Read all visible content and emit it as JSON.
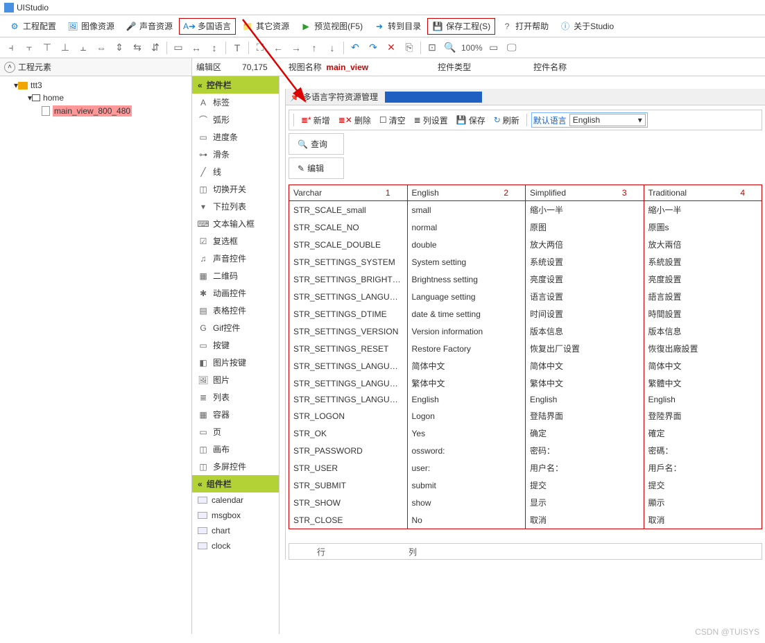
{
  "app_title": "UIStudio",
  "toolbar1": [
    {
      "id": "proj-config",
      "label": "工程配置",
      "icon": "gear"
    },
    {
      "id": "img-res",
      "label": "图像资源",
      "icon": "img"
    },
    {
      "id": "sound-res",
      "label": "声音资源",
      "icon": "mic"
    },
    {
      "id": "multi-lang",
      "label": "多国语言",
      "icon": "lang",
      "boxed": true
    },
    {
      "id": "other-res",
      "label": "其它资源",
      "icon": "folder"
    },
    {
      "id": "preview",
      "label": "预览视图(F5)",
      "icon": "play"
    },
    {
      "id": "goto-dir",
      "label": "转到目录",
      "icon": "goto"
    },
    {
      "id": "save-proj",
      "label": "保存工程(S)",
      "icon": "save",
      "boxed": true
    },
    {
      "id": "open-help",
      "label": "打开帮助",
      "icon": "help"
    },
    {
      "id": "about",
      "label": "关于Studio",
      "icon": "info"
    }
  ],
  "infobar": {
    "edit_area": "编辑区",
    "coords": "70,175",
    "view_name_label": "视图名称",
    "view_name": "main_view",
    "ctrl_type": "控件类型",
    "ctrl_name": "控件名称"
  },
  "left_header": "工程元素",
  "tree": {
    "root": "ttt3",
    "home": "home",
    "main": "main_view_800_480"
  },
  "mid": {
    "sec1": "控件栏",
    "items1": [
      {
        "id": "label",
        "label": "标签",
        "ic": "A"
      },
      {
        "id": "arc",
        "label": "弧形",
        "ic": "⌒"
      },
      {
        "id": "progress",
        "label": "进度条",
        "ic": "▭"
      },
      {
        "id": "slider",
        "label": "滑条",
        "ic": "⊶"
      },
      {
        "id": "line",
        "label": "线",
        "ic": "╱"
      },
      {
        "id": "switch",
        "label": "切换开关",
        "ic": "◫"
      },
      {
        "id": "dropdown",
        "label": "下拉列表",
        "ic": "▾"
      },
      {
        "id": "textinput",
        "label": "文本输入框",
        "ic": "⌨"
      },
      {
        "id": "checkbox",
        "label": "复选框",
        "ic": "☑"
      },
      {
        "id": "sound",
        "label": "声音控件",
        "ic": "♫"
      },
      {
        "id": "qrcode",
        "label": "二维码",
        "ic": "▦"
      },
      {
        "id": "anim",
        "label": "动画控件",
        "ic": "✱"
      },
      {
        "id": "table",
        "label": "表格控件",
        "ic": "▤"
      },
      {
        "id": "gif",
        "label": "Gif控件",
        "ic": "G"
      },
      {
        "id": "button",
        "label": "按键",
        "ic": "▭"
      },
      {
        "id": "imgbtn",
        "label": "图片按键",
        "ic": "◧"
      },
      {
        "id": "image",
        "label": "图片",
        "ic": "🖼"
      },
      {
        "id": "list",
        "label": "列表",
        "ic": "≣"
      },
      {
        "id": "container",
        "label": "容器",
        "ic": "▦"
      },
      {
        "id": "page",
        "label": "页",
        "ic": "▭"
      },
      {
        "id": "canvas",
        "label": "画布",
        "ic": "◫"
      },
      {
        "id": "multiscreen",
        "label": "多屏控件",
        "ic": "◫"
      }
    ],
    "sec2": "组件栏",
    "items2": [
      {
        "id": "calendar",
        "label": "calendar",
        "ic": "▭"
      },
      {
        "id": "msgbox",
        "label": "msgbox",
        "ic": "▭"
      },
      {
        "id": "chart",
        "label": "chart",
        "ic": "▭"
      },
      {
        "id": "clock",
        "label": "clock",
        "ic": "▭"
      }
    ]
  },
  "dialog": {
    "title": "多语言字符资源管理",
    "toolbar": {
      "add": "新增",
      "del": "删除",
      "clear": "清空",
      "colset": "列设置",
      "save": "保存",
      "refresh": "刷新",
      "def_lang_label": "默认语言",
      "def_lang": "English"
    },
    "tabs": {
      "query": "查询",
      "edit": "编辑"
    },
    "headers": [
      "Varchar",
      "English",
      "Simplified",
      "Traditional"
    ],
    "rows": [
      [
        "STR_SCALE_small",
        "small",
        "缩小一半",
        "縮小一半"
      ],
      [
        "STR_SCALE_NO",
        "normal",
        "原图",
        "原圖s"
      ],
      [
        "STR_SCALE_DOUBLE",
        "double",
        "放大两倍",
        "放大兩倍"
      ],
      [
        "STR_SETTINGS_SYSTEM",
        "System setting",
        "系统设置",
        "系統設置"
      ],
      [
        "STR_SETTINGS_BRIGHTNESS",
        "Brightness setting",
        "亮度设置",
        "亮度設置"
      ],
      [
        "STR_SETTINGS_LANGUAGE",
        "Language setting",
        "语言设置",
        "語言設置"
      ],
      [
        "STR_SETTINGS_DTIME",
        "date & time setting",
        "时间设置",
        "時間設置"
      ],
      [
        "STR_SETTINGS_VERSION",
        "Version information",
        "版本信息",
        "版本信息"
      ],
      [
        "STR_SETTINGS_RESET",
        "Restore Factory",
        "恢复出厂设置",
        "恢復出廠設置"
      ],
      [
        "STR_SETTINGS_LANGUAGE_SC",
        "简体中文",
        "简体中文",
        "简体中文"
      ],
      [
        "STR_SETTINGS_LANGUAGE_TC",
        "繁体中文",
        "繁体中文",
        "繁體中文"
      ],
      [
        "STR_SETTINGS_LANGUAGE_EN",
        "English",
        "English",
        "English"
      ],
      [
        "STR_LOGON",
        "Logon",
        "登陆界面",
        "登陸界面"
      ],
      [
        "STR_OK",
        "Yes",
        "确定",
        "確定"
      ],
      [
        "STR_PASSWORD",
        "ossword:",
        "密码：",
        "密碼："
      ],
      [
        "STR_USER",
        "user:",
        "用户名：",
        "用戶名："
      ],
      [
        "STR_SUBMIT",
        "submit",
        "提交",
        "提交"
      ],
      [
        "STR_SHOW",
        "show",
        "显示",
        "顯示"
      ],
      [
        "STR_CLOSE",
        "No",
        "取消",
        "取消"
      ]
    ],
    "status": {
      "row": "行",
      "col": "列"
    }
  },
  "zoom": "100%",
  "watermark": "CSDN @TUISYS"
}
